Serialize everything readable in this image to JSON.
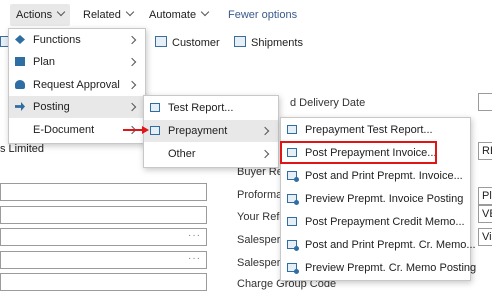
{
  "actionbar": {
    "items": [
      {
        "label": "Actions"
      },
      {
        "label": "Related"
      },
      {
        "label": "Automate"
      }
    ],
    "fewer_options": "Fewer options"
  },
  "subbar": {
    "customer": "Customer",
    "shipments": "Shipments"
  },
  "page": {
    "delivery_label": "d Delivery Date",
    "left_text": "s Limited",
    "buyer_label": "Buyer Re",
    "proforma_label": "Proforma",
    "your_ref_label": "Your Refe",
    "salesperson_label_1": "Salespers",
    "salesperson_label_2": "Salespers",
    "charge_group_label": "Charge Group Code",
    "right_stubs": [
      "RE",
      "Pl",
      "VE",
      "Vi"
    ]
  },
  "actions_menu": {
    "items": [
      {
        "label": "Functions",
        "icon": "functions-icon",
        "has_submenu": true
      },
      {
        "label": "Plan",
        "icon": "plan-icon",
        "has_submenu": true
      },
      {
        "label": "Request Approval",
        "icon": "request-approval-icon",
        "has_submenu": true
      },
      {
        "label": "Posting",
        "icon": "posting-icon",
        "has_submenu": true,
        "highlighted": true
      },
      {
        "label": "E-Document",
        "icon": "",
        "has_submenu": true
      }
    ]
  },
  "posting_menu": {
    "items": [
      {
        "label": "Test Report...",
        "icon": "test-report-icon"
      },
      {
        "label": "Prepayment",
        "icon": "prepayment-icon",
        "has_submenu": true,
        "highlighted": true
      },
      {
        "label": "Other",
        "has_submenu": true
      }
    ]
  },
  "prepayment_menu": {
    "items": [
      {
        "label": "Prepayment Test Report..."
      },
      {
        "label": "Post Prepayment Invoice..."
      },
      {
        "label": "Post and Print Prepmt. Invoice..."
      },
      {
        "label": "Preview Prepmt. Invoice Posting"
      },
      {
        "label": "Post Prepayment Credit Memo..."
      },
      {
        "label": "Post and Print Prepmt. Cr. Memo..."
      },
      {
        "label": "Preview Prepmt. Cr. Memo Posting"
      }
    ]
  },
  "colors": {
    "highlight_border": "#e01515",
    "menu_hover": "#e8e8e8",
    "icon_blue": "#2f6ea3"
  }
}
